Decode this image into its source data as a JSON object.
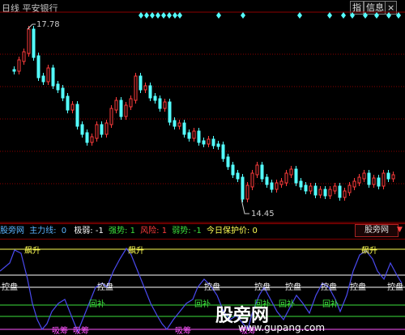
{
  "header": {
    "period": "日线",
    "stock_name": "平安银行",
    "buttons": [
      "指",
      "信息"
    ]
  },
  "price_chart": {
    "high_label": "17.78",
    "low_label": "14.45"
  },
  "indicator_bar": {
    "name": "股旁网",
    "main_line_label": "主力线:",
    "main_line_value": "0",
    "jiruo": "极弱: -1",
    "qiangshi": "强势: 1",
    "fengxian": "风险: 1",
    "ruoshi": "弱势: -1",
    "baohu": "今日保护价: 0",
    "dropdown_value": "股旁网"
  },
  "indicator_labels": {
    "piaosheng": "飙升",
    "konpan": "控盘",
    "huibu": "回补",
    "xichou": "吸筹"
  },
  "watermark": {
    "brand": "股旁网",
    "url": "www.gupang.com"
  },
  "colors": {
    "up": "#ff3c3c",
    "down": "#54ffff",
    "axis": "#8b0000",
    "diamond": "#54ffff",
    "indicator_line": "#4a4af0",
    "label_yellow": "#ffff54",
    "label_green": "#3ce03c",
    "label_white": "#ffffff",
    "label_magenta": "#ff54ff"
  }
}
